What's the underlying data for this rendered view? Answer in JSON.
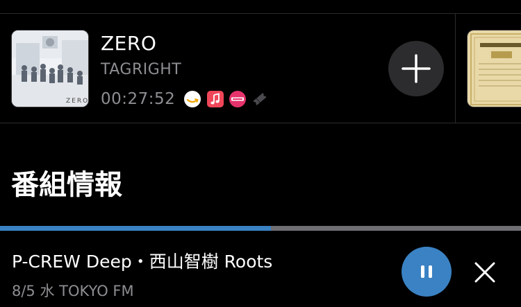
{
  "song": {
    "title": "ZERO",
    "artist": "TAGRIGHT",
    "time": "00:27:52",
    "artwork_text": "ZERO",
    "services": [
      "amazon-music-icon",
      "apple-music-icon",
      "recochoku-icon",
      "ticket-icon"
    ],
    "add_icon": "plus-icon"
  },
  "section": {
    "heading": "番組情報"
  },
  "player": {
    "progress": 0.52,
    "program_title": "P-CREW Deep・西山智樹 Roots",
    "date": "8/5 水",
    "station": "TOKYO FM",
    "pause_icon": "pause-icon",
    "close_icon": "close-icon",
    "accent_color": "#3a82c4"
  }
}
